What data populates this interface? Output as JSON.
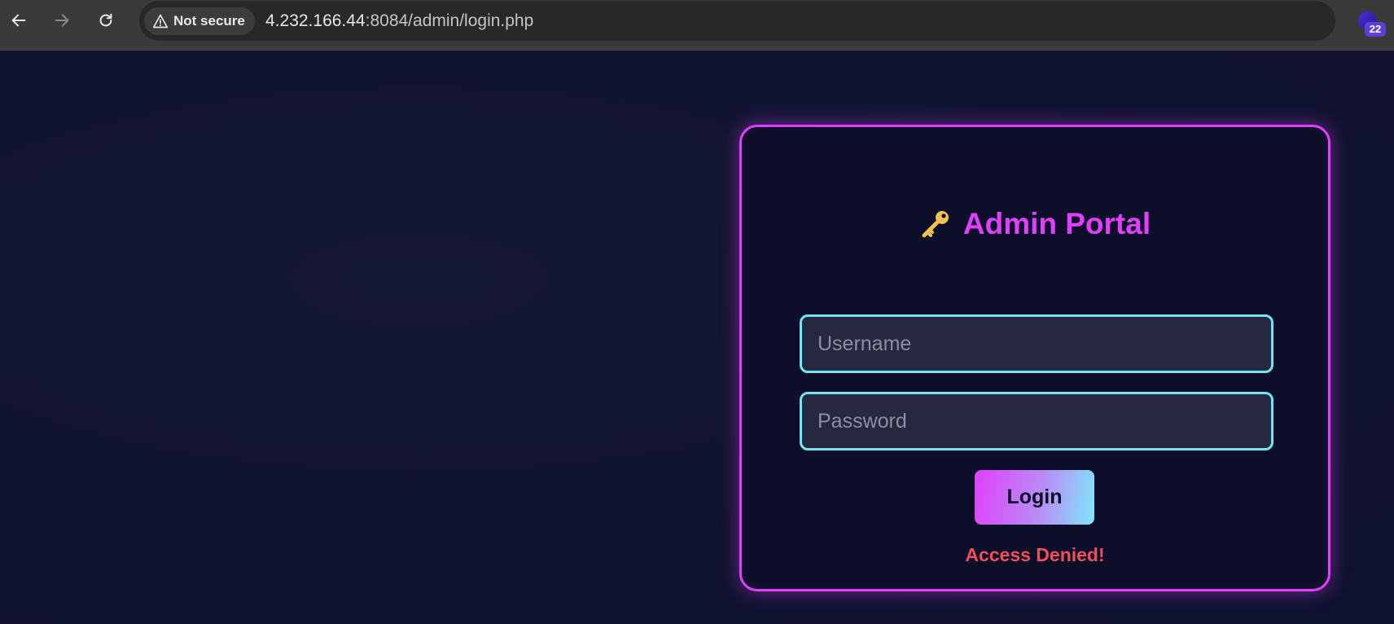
{
  "browser": {
    "security_label": "Not secure",
    "url_host": "4.232.166.44",
    "url_rest": ":8084/admin/login.php",
    "extension_badge": "22"
  },
  "login": {
    "title": "Admin Portal",
    "title_icon": "key-icon",
    "username_placeholder": "Username",
    "password_placeholder": "Password",
    "button_label": "Login",
    "error_message": "Access Denied!"
  },
  "colors": {
    "accent_magenta": "#e040fb",
    "accent_cyan": "#6fe6f2",
    "error_red": "#ef4f5a",
    "background": "#121530"
  }
}
